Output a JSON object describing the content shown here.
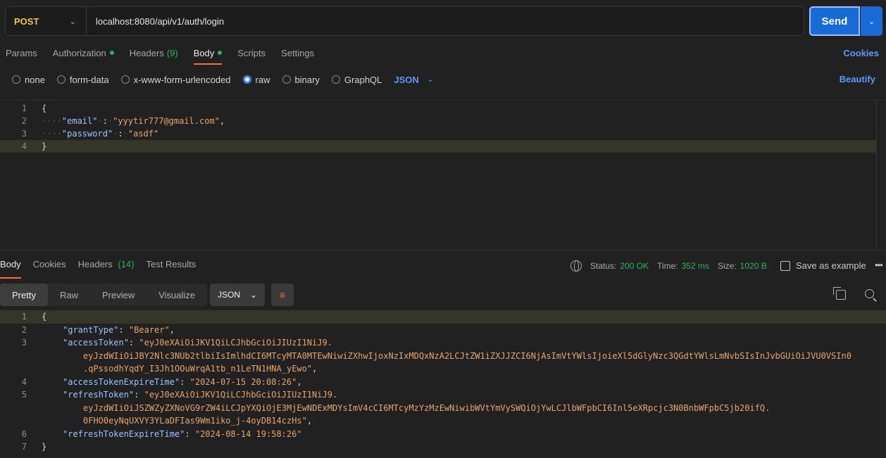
{
  "request": {
    "method": "POST",
    "url": "localhost:8080/api/v1/auth/login",
    "send_label": "Send"
  },
  "request_tabs": [
    {
      "label": "Params"
    },
    {
      "label": "Authorization"
    },
    {
      "label": "Headers",
      "count": "(9)"
    },
    {
      "label": "Body"
    },
    {
      "label": "Scripts"
    },
    {
      "label": "Settings"
    }
  ],
  "cookies_label": "Cookies",
  "body_types": [
    "none",
    "form-data",
    "x-www-form-urlencoded",
    "raw",
    "binary",
    "GraphQL"
  ],
  "body_language": "JSON",
  "beautify_label": "Beautify",
  "request_body": {
    "line_numbers": [
      "1",
      "2",
      "3",
      "4"
    ],
    "open": "{",
    "email_key": "\"email\"",
    "email_val": "\"yyytir777@gmail.com\"",
    "password_key": "\"password\"",
    "password_val": "\"asdf\"",
    "close": "}"
  },
  "response_tabs": [
    {
      "label": "Body"
    },
    {
      "label": "Cookies"
    },
    {
      "label": "Headers",
      "count": "(14)"
    },
    {
      "label": "Test Results"
    }
  ],
  "response_status": {
    "status_label": "Status:",
    "status_value": "200 OK",
    "time_label": "Time:",
    "time_value": "352 ms",
    "size_label": "Size:",
    "size_value": "1020 B"
  },
  "save_example_label": "Save as example",
  "more_label": "ooo",
  "view_modes": [
    "Pretty",
    "Raw",
    "Preview",
    "Visualize"
  ],
  "response_format": "JSON",
  "response_body": {
    "line_numbers": [
      "1",
      "2",
      "3",
      "",
      "",
      "4",
      "5",
      "",
      "",
      "6",
      "7"
    ],
    "open": "{",
    "grantType_key": "\"grantType\"",
    "grantType_val": "\"Bearer\"",
    "accessToken_key": "\"accessToken\"",
    "accessToken_val_1": "\"eyJ0eXAiOiJKV1QiLCJhbGciOiJIUzI1NiJ9.",
    "accessToken_val_2": "eyJzdWIiOiJBY2Nlc3NUb2tlbiIsImlhdCI6MTcyMTA0MTEwNiwiZXhwIjoxNzIxMDQxNzA2LCJtZW1iZXJJZCI6NjAsImVtYWlsIjoieXl5dGlyNzc3QGdtYWlsLmNvbSIsInJvbGUiOiJVU0VSIn0",
    "accessToken_val_3": ".qPssodhYqdY_I3Jh1OOuWrqA1tb_n1LeTN1HNA_yEwo\"",
    "accessTokenExpireTime_key": "\"accessTokenExpireTime\"",
    "accessTokenExpireTime_val": "\"2024-07-15 20:08:26\"",
    "refreshToken_key": "\"refreshToken\"",
    "refreshToken_val_1": "\"eyJ0eXAiOiJKV1QiLCJhbGciOiJIUzI1NiJ9.",
    "refreshToken_val_2": "eyJzdWIiOiJSZWZyZXNoVG9rZW4iLCJpYXQiOjE3MjEwNDExMDYsImV4cCI6MTcyMzYzMzEwNiwibWVtYmVySWQiOjYwLCJlbWFpbCI6Inl5eXRpcjc3N0BnbWFpbC5jb20ifQ.",
    "refreshToken_val_3": "0FHO0eyNqUXVY3YLaDFIas9Wm1iko_j-4oyDB14czHs\"",
    "refreshTokenExpireTime_key": "\"refreshTokenExpireTime\"",
    "refreshTokenExpireTime_val": "\"2024-08-14 19:58:26\"",
    "close": "}"
  }
}
